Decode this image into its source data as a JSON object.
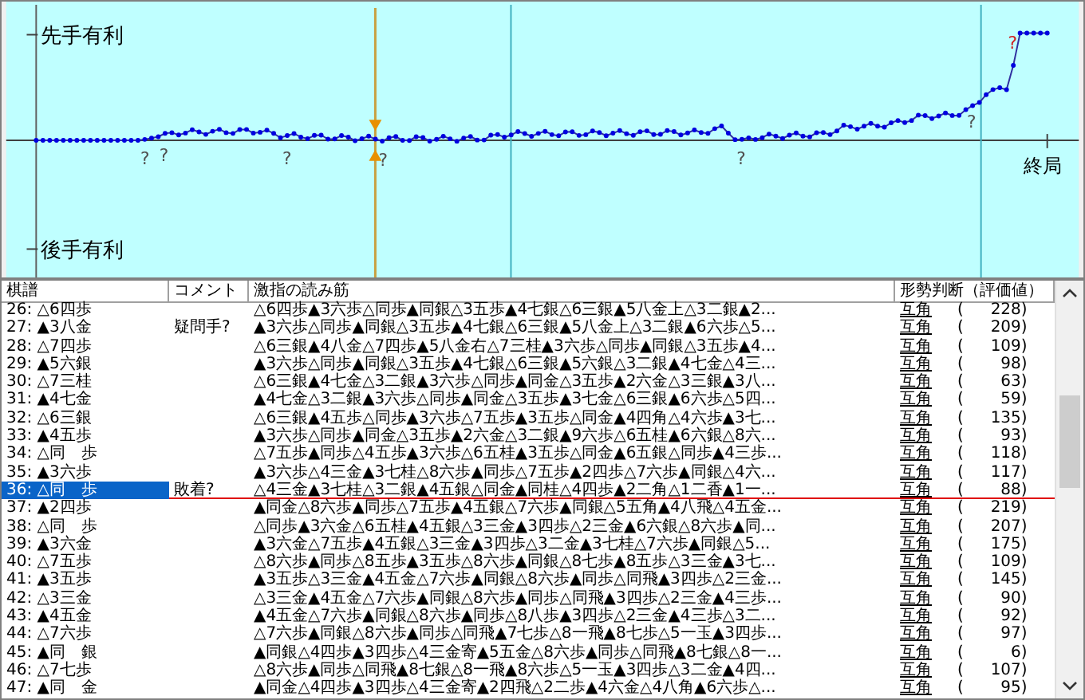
{
  "graph": {
    "top_label": "先手有利",
    "bottom_label": "後手有利",
    "end_label": "終局",
    "question_marks": [
      "?",
      "?",
      "?",
      "?",
      "?",
      "?",
      "?"
    ]
  },
  "table": {
    "columns": [
      "棋譜",
      "コメント",
      "激指の読み筋",
      "形勢判断（評価値）"
    ],
    "rows": [
      {
        "move": "26: △6四歩",
        "comment": "",
        "line": "△6四歩▲3六歩△同歩▲同銀△3五歩▲4七銀△6三銀▲5八金上△3二銀▲2...",
        "judgement": "互角",
        "paren": [
          "(",
          ")"
        ],
        "score": "228",
        "selected": false
      },
      {
        "move": "27: ▲3八金",
        "comment": "疑問手?",
        "line": "▲3六歩△同歩▲同銀△3五歩▲4七銀△6三銀▲5八金上△3二銀▲6六歩△5...",
        "judgement": "互角",
        "paren": [
          "(",
          ")"
        ],
        "score": "209",
        "selected": false
      },
      {
        "move": "28: △7四歩",
        "comment": "",
        "line": "△6三銀▲4八金△7四歩▲5八金右△7三桂▲3六歩△同歩▲同銀△3五歩▲4...",
        "judgement": "互角",
        "paren": [
          "(",
          ")"
        ],
        "score": "109",
        "selected": false
      },
      {
        "move": "29: ▲5六銀",
        "comment": "",
        "line": "▲3六歩△同歩▲同銀△3五歩▲4七銀△6三銀▲5六銀△3二銀▲4七金△4三...",
        "judgement": "互角",
        "paren": [
          "(",
          ")"
        ],
        "score": "98",
        "selected": false
      },
      {
        "move": "30: △7三桂",
        "comment": "",
        "line": "△6三銀▲4七金△3二銀▲3六歩△同歩▲同金△3五歩▲2六金△3三銀▲3八...",
        "judgement": "互角",
        "paren": [
          "(",
          ")"
        ],
        "score": "63",
        "selected": false
      },
      {
        "move": "31: ▲4七金",
        "comment": "",
        "line": "▲4七金△3二銀▲3六歩△同歩▲同金△3五歩▲3七金△6三銀▲6六歩△5四...",
        "judgement": "互角",
        "paren": [
          "(",
          ")"
        ],
        "score": "59",
        "selected": false
      },
      {
        "move": "32: △6三銀",
        "comment": "",
        "line": "△6三銀▲4五歩△同歩▲3六歩△7五歩▲3五歩△同金▲4四角△4六歩▲3七...",
        "judgement": "互角",
        "paren": [
          "(",
          ")"
        ],
        "score": "135",
        "selected": false
      },
      {
        "move": "33: ▲4五歩",
        "comment": "",
        "line": "▲3六歩△同歩▲同金△3五歩▲2六金△3二銀▲9六歩△6五桂▲6六銀△8六...",
        "judgement": "互角",
        "paren": [
          "(",
          ")"
        ],
        "score": "93",
        "selected": false
      },
      {
        "move": "34: △同　歩",
        "comment": "",
        "line": "△7五歩▲同歩△4五歩▲3六歩△6五桂▲3五歩△同金▲6五銀△同歩▲4三歩...",
        "judgement": "互角",
        "paren": [
          "(",
          ")"
        ],
        "score": "118",
        "selected": false
      },
      {
        "move": "35: ▲3六歩",
        "comment": "",
        "line": "▲3六歩△4三金▲3七桂△8六歩▲同歩△7五歩▲2四歩△7六歩▲同銀△4六...",
        "judgement": "互角",
        "paren": [
          "(",
          ")"
        ],
        "score": "117",
        "selected": false
      },
      {
        "move": "36: △同　歩",
        "comment": "敗着?",
        "line": "△4三金▲3七桂△3二銀▲4五銀△同金▲同桂△4四歩▲2二角△1二香▲1一...",
        "judgement": "互角",
        "paren": [
          "(",
          ")"
        ],
        "score": "88",
        "selected": true
      },
      {
        "move": "37: ▲2四歩",
        "comment": "",
        "line": "▲同金△8六歩▲同歩△7五歩▲4五銀△7六歩▲同銀△5五角▲4八飛△4五金...",
        "judgement": "互角",
        "paren": [
          "(",
          ")"
        ],
        "score": "219",
        "selected": false
      },
      {
        "move": "38: △同　歩",
        "comment": "",
        "line": "△同歩▲3六金△6五桂▲4五銀△3三金▲3四歩△2三金▲6六銀△8六歩▲同...",
        "judgement": "互角",
        "paren": [
          "(",
          ")"
        ],
        "score": "207",
        "selected": false
      },
      {
        "move": "39: ▲3六金",
        "comment": "",
        "line": "▲3六金△7五歩▲4五銀△3三金▲3四歩△3二金▲3七桂△7六歩▲同銀△5...",
        "judgement": "互角",
        "paren": [
          "(",
          ")"
        ],
        "score": "175",
        "selected": false
      },
      {
        "move": "40: △7五歩",
        "comment": "",
        "line": "△8六歩▲同歩△8五歩▲3五歩△8六歩▲同銀△8七歩▲8五歩△3三金▲3七...",
        "judgement": "互角",
        "paren": [
          "(",
          ")"
        ],
        "score": "109",
        "selected": false
      },
      {
        "move": "41: ▲3五歩",
        "comment": "",
        "line": "▲3五歩△3三金▲4五金△7六歩▲同銀△8六歩▲同歩△同飛▲3四歩△2三金...",
        "judgement": "互角",
        "paren": [
          "(",
          ")"
        ],
        "score": "145",
        "selected": false
      },
      {
        "move": "42: △3三金",
        "comment": "",
        "line": "△3三金▲4五金△7六歩▲同銀△8六歩▲同歩△同飛▲3四歩△2三金▲4三歩...",
        "judgement": "互角",
        "paren": [
          "(",
          ")"
        ],
        "score": "90",
        "selected": false
      },
      {
        "move": "43: ▲4五金",
        "comment": "",
        "line": "▲4五金△7六歩▲同銀△8六歩▲同歩△8八歩▲3四歩△2三金▲4三歩△3二...",
        "judgement": "互角",
        "paren": [
          "(",
          ")"
        ],
        "score": "92",
        "selected": false
      },
      {
        "move": "44: △7六歩",
        "comment": "",
        "line": "△7六歩▲同銀△8六歩▲同歩△同飛▲7七歩△8一飛▲8七歩△5一玉▲3四歩...",
        "judgement": "互角",
        "paren": [
          "(",
          ")"
        ],
        "score": "97",
        "selected": false
      },
      {
        "move": "45: ▲同　銀",
        "comment": "",
        "line": "▲同銀△4四歩▲3四歩△4三金寄▲5五金△8六歩▲同歩△同飛▲8七銀△8一...",
        "judgement": "互角",
        "paren": [
          "(",
          ")"
        ],
        "score": "6",
        "selected": false
      },
      {
        "move": "46: △7七歩",
        "comment": "",
        "line": "△8六歩▲同歩△同飛▲8七銀△8一飛▲8六歩△5一玉▲3四歩△3二金▲4四...",
        "judgement": "互角",
        "paren": [
          "(",
          ")"
        ],
        "score": "107",
        "selected": false
      },
      {
        "move": "47: ▲同　金",
        "comment": "",
        "line": "▲同金△4四歩▲3四歩△4三金寄▲2四飛△2二歩▲4六金△4八角▲6六歩△...",
        "judgement": "互角",
        "paren": [
          "(",
          ")"
        ],
        "score": "95",
        "selected": false
      }
    ]
  }
}
